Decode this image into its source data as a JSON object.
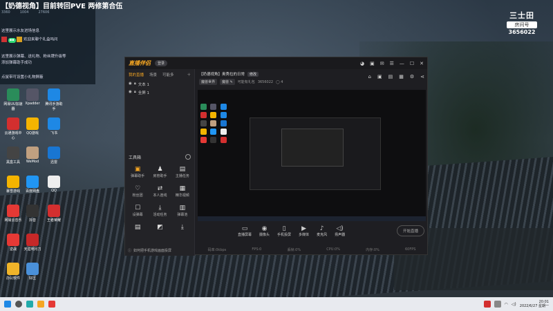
{
  "chat": {
    "title": "【奶德视角】目前转回PVE 两修第合伍",
    "stats": [
      "3360",
      "1004",
      "27606"
    ],
    "tip1": "这里展示水友进场信息",
    "user1": "欢迎来聊个礼盒吗问",
    "tip2": "这里展示弹幕、送礼物、粉丝牌升级等",
    "tip3": "添加弹幕助手成功",
    "tip4": "点鼠带可设置小礼物屏蔽"
  },
  "desktop_icons": [
    {
      "label": "网易UU加速器",
      "color": "#2a8c5a"
    },
    {
      "label": "Xpadder",
      "color": "#556"
    },
    {
      "label": "腾讯手游助手",
      "color": "#1e88e5"
    },
    {
      "label": "云通游戏中心",
      "color": "#d32f2f"
    },
    {
      "label": "QQ游戏",
      "color": "#f4b400"
    },
    {
      "label": "飞书",
      "color": "#1e88e5"
    },
    {
      "label": "黑盒工具",
      "color": "#444"
    },
    {
      "label": "WeMod",
      "color": "#c0a080"
    },
    {
      "label": "迅雷",
      "color": "#1976d2"
    },
    {
      "label": "暴雪游戏",
      "color": "#f4b400"
    },
    {
      "label": "百度网盘",
      "color": "#2196f3"
    },
    {
      "label": "QQ",
      "color": "#eee"
    },
    {
      "label": "网易云音乐",
      "color": "#e53935"
    },
    {
      "label": "抖音",
      "color": "#333"
    },
    {
      "label": "王者荣耀",
      "color": "#d32f2f"
    },
    {
      "label": "逆战",
      "color": "#e53935"
    },
    {
      "label": "天涯明月刀",
      "color": "#c62828"
    },
    {
      "label": "办公软件",
      "color": "#f0b429"
    },
    {
      "label": "好压",
      "color": "#4a90d9"
    }
  ],
  "room": {
    "logo": "三士田",
    "label": "房间号",
    "number": "3656022"
  },
  "window": {
    "app_name": "直播伴侣",
    "pill": "登录",
    "tabs": [
      "我的直播",
      "场景",
      "可能多"
    ],
    "layers": [
      "文本 1",
      "全屏 1"
    ],
    "toolbox_title": "工具箱",
    "tools": [
      {
        "label": "弹幕助手",
        "glyph": "▣",
        "hot": true
      },
      {
        "label": "房管助手",
        "glyph": "♟",
        "hot": false
      },
      {
        "label": "主播任务",
        "glyph": "▤",
        "hot": false
      },
      {
        "label": "粉丝团",
        "glyph": "♡",
        "hot": false
      },
      {
        "label": "本人连线",
        "glyph": "⇄",
        "hot": false
      },
      {
        "label": "精华视频",
        "glyph": "▦",
        "hot": false
      },
      {
        "label": "设弹幕",
        "glyph": "☐",
        "hot": false
      },
      {
        "label": "活动任务",
        "glyph": "⤓",
        "hot": false
      },
      {
        "label": "弹幕池",
        "glyph": "▥",
        "hot": false
      },
      {
        "label": "",
        "glyph": "▤",
        "hot": false
      },
      {
        "label": "",
        "glyph": "◩",
        "hot": false
      },
      {
        "label": "",
        "glyph": "⤓",
        "hot": false
      }
    ],
    "tip": "如何把手机游戏画面投屏",
    "stream_title": "【奶德视角】奥秀拉的日常",
    "stream_tag": "修改",
    "rh2": [
      "魔兽世界",
      "魔兽 ✎",
      "可能有礼包",
      "3656022",
      "◯ 4"
    ],
    "bottom_buttons": [
      {
        "label": "直播屏幕",
        "glyph": "▭"
      },
      {
        "label": "摄像头",
        "glyph": "◉"
      },
      {
        "label": "手机投屏",
        "glyph": "▯"
      },
      {
        "label": "多媒体",
        "glyph": "▶"
      },
      {
        "label": "麦克风",
        "glyph": "♪"
      },
      {
        "label": "扬声器",
        "glyph": "◁)"
      }
    ],
    "start_live": "开始直播",
    "status": [
      "码率:0kbps",
      "FPS:0",
      "丢帧:0%",
      "CPU:0%",
      "内存:0%",
      "60FPS"
    ]
  },
  "clock": {
    "time": "20:01",
    "date": "2022/6/27 星期一"
  }
}
